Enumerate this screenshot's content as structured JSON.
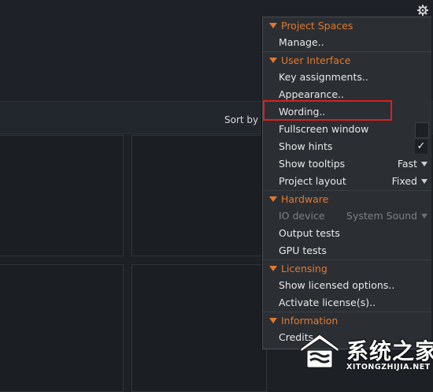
{
  "background": {
    "sort_label": "Sort by n"
  },
  "menu": {
    "sections": {
      "project_spaces": {
        "title": "Project Spaces",
        "items": {
          "manage": "Manage.."
        }
      },
      "user_interface": {
        "title": "User Interface",
        "items": {
          "key_assignments": "Key assignments..",
          "appearance": "Appearance..",
          "wording": "Wording..",
          "fullscreen": "Fullscreen window",
          "show_hints": "Show hints",
          "show_hints_check": "✓",
          "show_tooltips": "Show tooltips",
          "show_tooltips_value": "Fast",
          "project_layout": "Project layout",
          "project_layout_value": "Fixed"
        }
      },
      "hardware": {
        "title": "Hardware",
        "items": {
          "io_device": "IO device",
          "io_device_value": "System Sound",
          "output_tests": "Output tests",
          "gpu_tests": "GPU tests"
        }
      },
      "licensing": {
        "title": "Licensing",
        "items": {
          "show_licensed": "Show licensed options..",
          "activate_license": "Activate license(s).."
        }
      },
      "information": {
        "title": "Information",
        "items": {
          "credits": "Credits"
        }
      }
    }
  },
  "watermark": {
    "cn": "系统之家",
    "en": "XITONGZHIJIA.NET"
  },
  "colors": {
    "accent": "#e2782c",
    "highlight": "#d9201f",
    "menu_bg": "#2b2f34"
  }
}
